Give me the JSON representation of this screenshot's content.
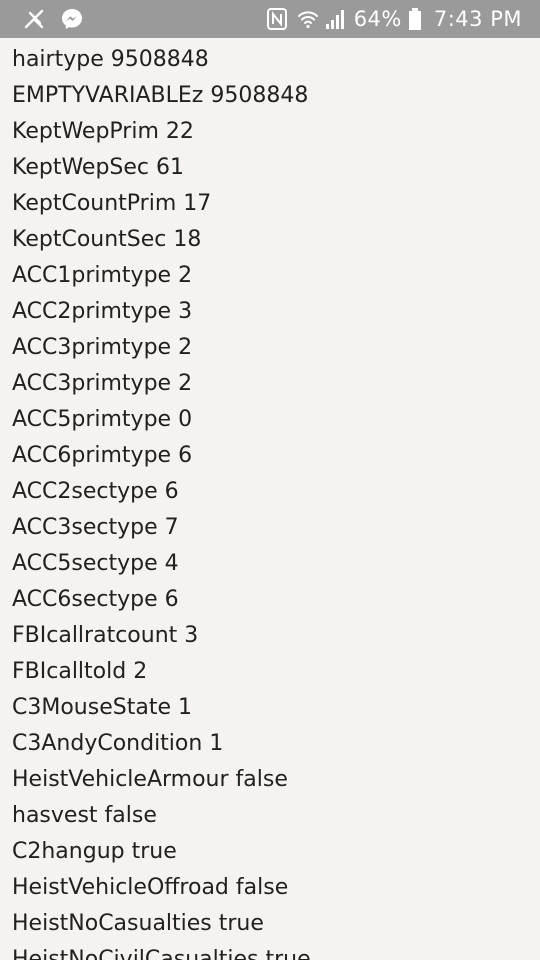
{
  "status_bar": {
    "icons_left": [
      "antenna-icon",
      "messenger-icon"
    ],
    "icons_right": [
      "nfc-icon",
      "wifi-icon",
      "signal-icon"
    ],
    "battery_percent": "64%",
    "time": "7:43 PM"
  },
  "lines": [
    "hairtype 9508848",
    "EMPTYVARIABLEz 9508848",
    "KeptWepPrim 22",
    "KeptWepSec 61",
    "KeptCountPrim 17",
    "KeptCountSec 18",
    "ACC1primtype 2",
    "ACC2primtype 3",
    "ACC3primtype 2",
    "ACC3primtype 2",
    "ACC5primtype 0",
    "ACC6primtype 6",
    "ACC2sectype 6",
    "ACC3sectype 7",
    "ACC5sectype 4",
    "ACC6sectype 6",
    "FBIcallratcount 3",
    "FBIcalltold 2",
    "C3MouseState 1",
    "C3AndyCondition 1",
    "HeistVehicleArmour false",
    "hasvest false",
    "C2hangup true",
    "HeistVehicleOffroad false",
    "HeistNoCasualties true",
    "HeistNoCivilCasualties true"
  ]
}
